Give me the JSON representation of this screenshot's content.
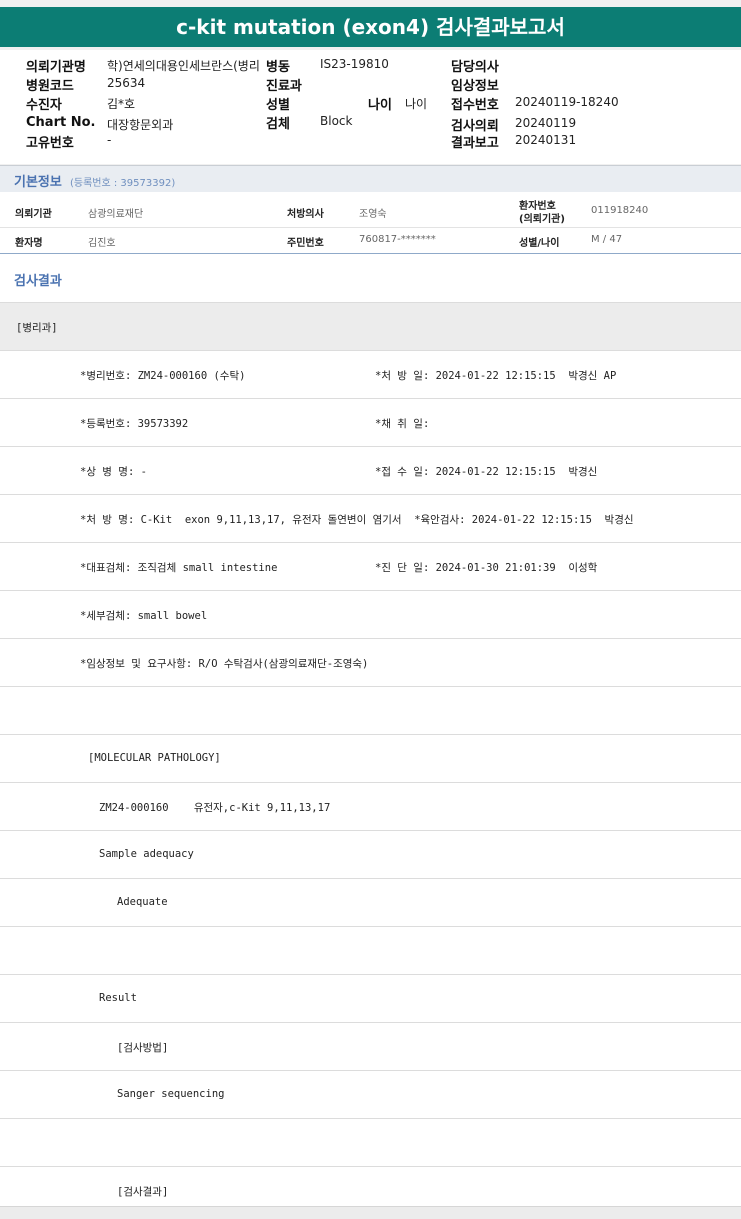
{
  "title": "c-kit mutation (exon4) 검사결과보고서",
  "header": {
    "left": [
      {
        "label": "의뢰기관명",
        "value": "학)연세의대용인세브란스(병리"
      },
      {
        "label": "병원코드",
        "value": "25634"
      },
      {
        "label": "수진자",
        "value": "김*호"
      },
      {
        "label": "Chart No.",
        "value": "대장항문외과"
      },
      {
        "label": "고유번호",
        "value": "-"
      }
    ],
    "middle": [
      {
        "label": "병동",
        "value": "IS23-19810"
      },
      {
        "label": "진료과",
        "value": ""
      },
      {
        "label": "성별",
        "value": ""
      },
      {
        "label": "검체",
        "value": "Block"
      }
    ],
    "age": {
      "label": "나이",
      "value": "나이"
    },
    "right": [
      {
        "label": "담당의사",
        "value": ""
      },
      {
        "label": "임상정보",
        "value": ""
      },
      {
        "label": "접수번호",
        "value": "20240119-18240"
      },
      {
        "label": "검사의뢰",
        "value": "20240119"
      },
      {
        "label": "결과보고",
        "value": "20240131"
      }
    ]
  },
  "basic_info": {
    "title": "기본정보",
    "sub": "(등록번호 : 39573392)",
    "row1": {
      "org_label": "의뢰기관",
      "org_value": "삼광의료재단",
      "doctor_label": "처방의사",
      "doctor_value": "조영숙",
      "patno_label": "환자번호",
      "patno_label2": "(의뢰기관)",
      "patno_value": "011918240"
    },
    "row2": {
      "name_label": "환자명",
      "name_value": "김진호",
      "rrn_label": "주민번호",
      "rrn_value": "760817-*******",
      "sexage_label": "성별/나이",
      "sexage_value": "M / 47"
    }
  },
  "result": {
    "title": "검사결과",
    "rows": [
      {
        "left": "[병리과]",
        "right": ""
      },
      {
        "left": "*병리번호: ZM24-000160 (수탁)",
        "right": "*처 방 일: 2024-01-22 12:15:15  박경신 AP"
      },
      {
        "left": "*등록번호: 39573392",
        "right": "*채 취 일:"
      },
      {
        "left": "*상 병 명: -",
        "right": "*접 수 일: 2024-01-22 12:15:15  박경신"
      },
      {
        "left": "*처 방 명: C-Kit  exon 9,11,13,17, 유전자 돌연변이 염기서  *육안검사: 2024-01-22 12:15:15  박경신",
        "right": ""
      },
      {
        "left": "*대표검체: 조직검체 small intestine",
        "right": "*진 단 일: 2024-01-30 21:01:39  이성학"
      },
      {
        "left": "*세부검체: small bowel",
        "right": ""
      },
      {
        "left": "*임상정보 및 요구사항: R/O 수탁검사(삼광의료재단-조영숙)",
        "right": ""
      },
      {
        "left": "",
        "right": ""
      },
      {
        "left": "[MOLECULAR PATHOLOGY]",
        "right": ""
      },
      {
        "left": "ZM24-000160    유전자,c-Kit 9,11,13,17",
        "right": ""
      },
      {
        "left": "Sample adequacy",
        "right": ""
      },
      {
        "left": "Adequate",
        "right": ""
      },
      {
        "left": "",
        "right": ""
      },
      {
        "left": "Result",
        "right": ""
      },
      {
        "left": "[검사방법]",
        "right": ""
      },
      {
        "left": "Sanger sequencing",
        "right": ""
      },
      {
        "left": "",
        "right": ""
      },
      {
        "left": "[검사결과]",
        "right": ""
      }
    ]
  }
}
